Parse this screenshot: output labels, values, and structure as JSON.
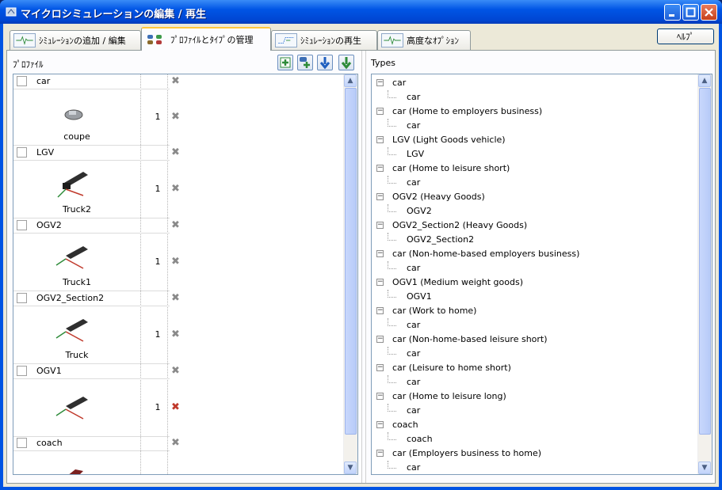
{
  "window": {
    "title": "マイクロシミュレーションの編集 / 再生"
  },
  "tabs": [
    {
      "label": "ｼﾐｭﾚｰｼｮﾝの追加 / 編集",
      "icon": "waveform-icon"
    },
    {
      "label": "ﾌﾟﾛﾌｧｲﾙとﾀｲﾌﾟの管理",
      "icon": "vehicles-icon"
    },
    {
      "label": "ｼﾐｭﾚｰｼｮﾝの再生",
      "icon": "playback-icon"
    },
    {
      "label": "高度なｵﾌﾟｼｮﾝ",
      "icon": "waveform-icon"
    }
  ],
  "help_label": "ﾍﾙﾌﾟ",
  "profiles": {
    "title": "ﾌﾟﾛﾌｧｲﾙ",
    "rows": [
      {
        "name": "car",
        "vehicle": "coupe",
        "count": "1",
        "delete_color": "gray"
      },
      {
        "name": "LGV",
        "vehicle": "Truck2",
        "count": "1",
        "delete_color": "gray"
      },
      {
        "name": "OGV2",
        "vehicle": "Truck1",
        "count": "1",
        "delete_color": "gray"
      },
      {
        "name": "OGV2_Section2",
        "vehicle": "Truck",
        "count": "1",
        "delete_color": "gray"
      },
      {
        "name": "OGV1",
        "vehicle": "",
        "count": "1",
        "delete_color": "red"
      },
      {
        "name": "coach",
        "vehicle": "",
        "count": "",
        "delete_color": "gray"
      }
    ]
  },
  "types": {
    "title": "Types",
    "nodes": [
      {
        "label": "car",
        "child": "car"
      },
      {
        "label": "car (Home to employers business)",
        "child": "car"
      },
      {
        "label": "LGV (Light Goods vehicle)",
        "child": "LGV"
      },
      {
        "label": "car (Home to leisure short)",
        "child": "car"
      },
      {
        "label": "OGV2 (Heavy Goods)",
        "child": "OGV2"
      },
      {
        "label": "OGV2_Section2 (Heavy Goods)",
        "child": "OGV2_Section2"
      },
      {
        "label": "car (Non-home-based employers business)",
        "child": "car"
      },
      {
        "label": "OGV1 (Medium weight goods)",
        "child": "OGV1"
      },
      {
        "label": "car (Work to home)",
        "child": "car"
      },
      {
        "label": "car (Non-home-based leisure short)",
        "child": "car"
      },
      {
        "label": "car (Leisure to home short)",
        "child": "car"
      },
      {
        "label": "car (Home to leisure long)",
        "child": "car"
      },
      {
        "label": "coach",
        "child": "coach"
      },
      {
        "label": "car (Employers business to home)",
        "child": "car"
      }
    ]
  },
  "colors": {
    "titlebar": "#0055e5",
    "tab_highlight": "#ffc83c",
    "delete_active": "#c0392b"
  }
}
